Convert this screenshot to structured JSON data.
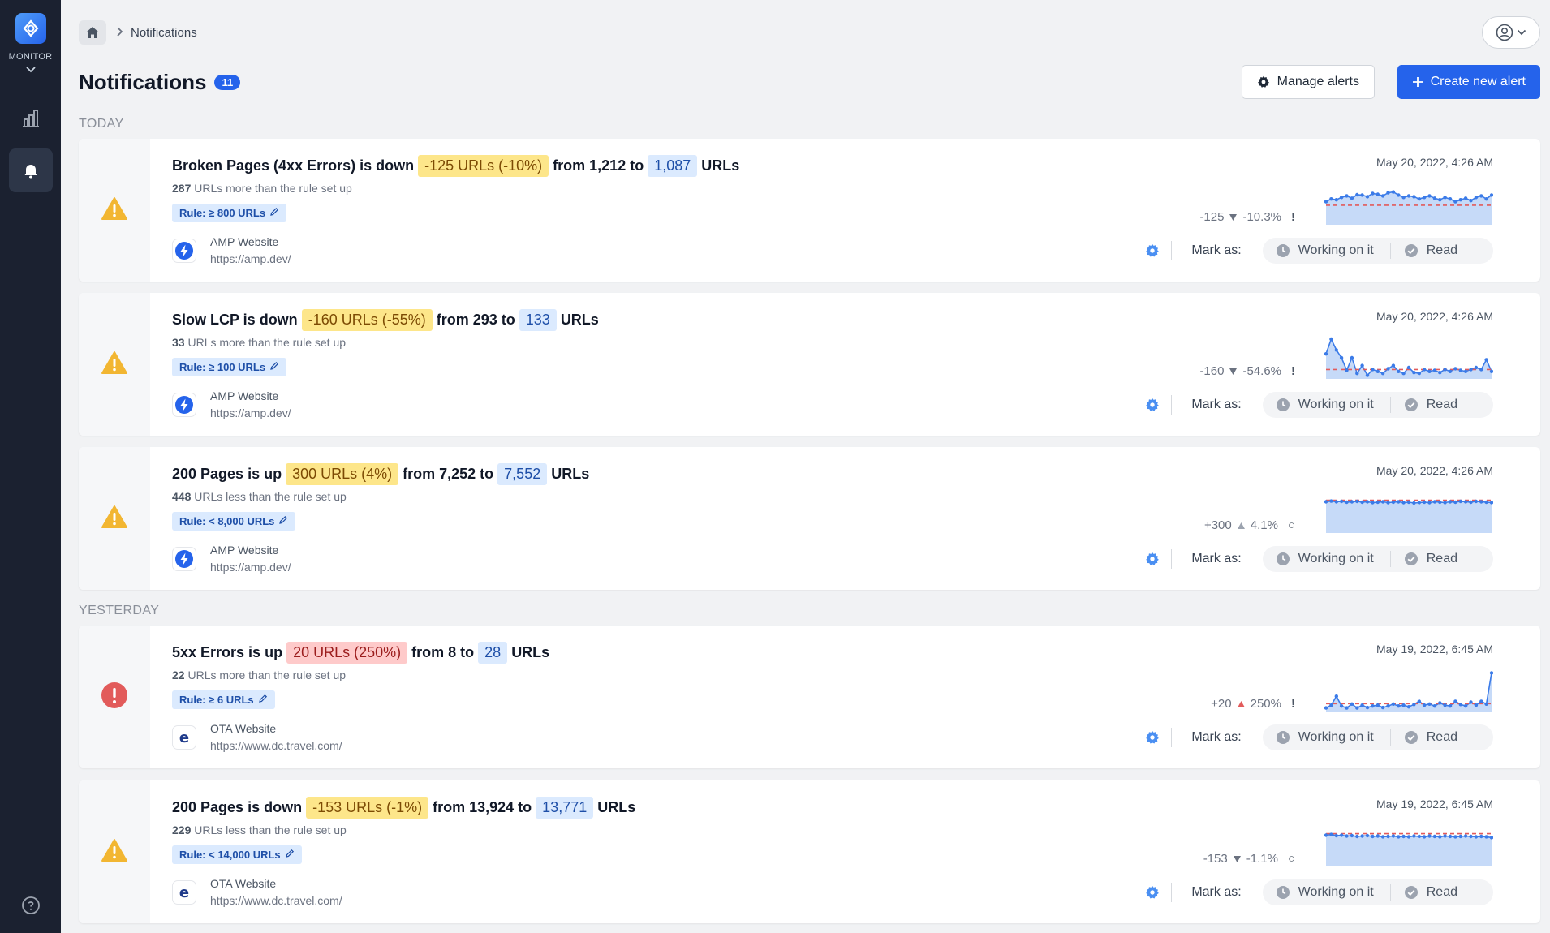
{
  "sidebar": {
    "app_label": "MONITOR",
    "items": [
      {
        "name": "charts",
        "icon": "bar-chart-icon"
      },
      {
        "name": "notifications",
        "icon": "bell-icon",
        "active": true
      }
    ],
    "help_icon": "help-icon"
  },
  "breadcrumb": {
    "home_icon": "home-icon",
    "current": "Notifications"
  },
  "header": {
    "title": "Notifications",
    "count": "11",
    "manage_label": "Manage alerts",
    "create_label": "Create new alert"
  },
  "sections": {
    "today": "TODAY",
    "yesterday": "YESTERDAY"
  },
  "mark_as_label": "Mark as:",
  "working_label": "Working on it",
  "read_label": "Read",
  "colors": {
    "accent": "#2563eb",
    "warning": "#f2b632",
    "error": "#e25b5b"
  },
  "notifications": [
    {
      "severity": "warning",
      "metric": "Broken Pages (4xx Errors) is down",
      "change": "-125 URLs (-10%)",
      "change_color": "yellow",
      "from_text": "from 1,212 to",
      "to_value": "1,087",
      "unit": "URLs",
      "sub_count": "287",
      "sub_text": "URLs more than the rule set up",
      "rule": "Rule: ≥ 800 URLs",
      "site_name": "AMP Website",
      "site_url": "https://amp.dev/",
      "site_icon": "amp",
      "date": "May 20, 2022, 4:26 AM",
      "delta": "-125",
      "direction": "down",
      "pct": "-10.3%",
      "status_mark": "!",
      "spark": [
        0.55,
        0.62,
        0.6,
        0.66,
        0.7,
        0.64,
        0.73,
        0.72,
        0.68,
        0.76,
        0.74,
        0.7,
        0.78,
        0.8,
        0.72,
        0.66,
        0.7,
        0.68,
        0.62,
        0.66,
        0.7,
        0.64,
        0.6,
        0.66,
        0.62,
        0.55,
        0.6,
        0.64,
        0.58,
        0.66,
        0.7,
        0.62,
        0.72
      ],
      "threshold": 0.46
    },
    {
      "severity": "warning",
      "metric": "Slow LCP is down",
      "change": "-160 URLs (-55%)",
      "change_color": "yellow",
      "from_text": "from 293 to",
      "to_value": "133",
      "unit": "URLs",
      "sub_count": "33",
      "sub_text": "URLs more than the rule set up",
      "rule": "Rule: ≥ 100 URLs",
      "site_name": "AMP Website",
      "site_url": "https://amp.dev/",
      "site_icon": "amp",
      "date": "May 20, 2022, 4:26 AM",
      "delta": "-160",
      "direction": "down",
      "pct": "-54.6%",
      "status_mark": "!",
      "spark": [
        0.6,
        0.98,
        0.7,
        0.5,
        0.18,
        0.5,
        0.1,
        0.3,
        0.05,
        0.2,
        0.15,
        0.1,
        0.22,
        0.3,
        0.15,
        0.1,
        0.25,
        0.12,
        0.1,
        0.2,
        0.15,
        0.18,
        0.12,
        0.2,
        0.15,
        0.22,
        0.18,
        0.15,
        0.2,
        0.25,
        0.2,
        0.45,
        0.15
      ],
      "threshold": 0.2
    },
    {
      "severity": "warning",
      "metric": "200 Pages is up",
      "change": "300 URLs (4%)",
      "change_color": "yellow",
      "from_text": "from 7,252 to",
      "to_value": "7,552",
      "unit": "URLs",
      "sub_count": "448",
      "sub_text": "URLs less than the rule set up",
      "rule": "Rule: < 8,000 URLs",
      "site_name": "AMP Website",
      "site_url": "https://amp.dev/",
      "site_icon": "amp",
      "date": "May 20, 2022, 4:26 AM",
      "delta": "+300",
      "direction": "up",
      "pct": "4.1%",
      "status_mark": "○",
      "spark": [
        0.76,
        0.78,
        0.76,
        0.77,
        0.75,
        0.76,
        0.77,
        0.75,
        0.76,
        0.74,
        0.75,
        0.76,
        0.74,
        0.75,
        0.76,
        0.74,
        0.75,
        0.73,
        0.74,
        0.75,
        0.74,
        0.76,
        0.75,
        0.74,
        0.76,
        0.75,
        0.77,
        0.76,
        0.75,
        0.77,
        0.76,
        0.75,
        0.74
      ],
      "threshold": 0.8
    },
    {
      "severity": "error",
      "metric": "5xx Errors is up",
      "change": "20 URLs (250%)",
      "change_color": "red",
      "from_text": "from 8 to",
      "to_value": "28",
      "unit": "URLs",
      "sub_count": "22",
      "sub_text": "URLs more than the rule set up",
      "rule": "Rule: ≥ 6 URLs",
      "site_name": "OTA Website",
      "site_url": "https://www.dc.travel.com/",
      "site_icon": "e",
      "date": "May 19, 2022, 6:45 AM",
      "delta": "+20",
      "direction": "up",
      "pct": "250%",
      "status_mark": "!",
      "spark": [
        0.05,
        0.12,
        0.35,
        0.1,
        0.05,
        0.15,
        0.05,
        0.12,
        0.06,
        0.1,
        0.12,
        0.06,
        0.1,
        0.15,
        0.1,
        0.12,
        0.08,
        0.14,
        0.22,
        0.12,
        0.15,
        0.1,
        0.18,
        0.12,
        0.1,
        0.22,
        0.14,
        0.1,
        0.2,
        0.12,
        0.22,
        0.15,
        0.95
      ],
      "threshold": 0.16
    },
    {
      "severity": "warning",
      "metric": "200 Pages is down",
      "change": "-153 URLs (-1%)",
      "change_color": "yellow",
      "from_text": "from 13,924 to",
      "to_value": "13,771",
      "unit": "URLs",
      "sub_count": "229",
      "sub_text": "URLs less than the rule set up",
      "rule": "Rule: < 14,000 URLs",
      "site_name": "OTA Website",
      "site_url": "https://www.dc.travel.com/",
      "site_icon": "e",
      "date": "May 19, 2022, 6:45 AM",
      "delta": "-153",
      "direction": "down",
      "pct": "-1.1%",
      "status_mark": "○",
      "spark": [
        0.76,
        0.78,
        0.75,
        0.76,
        0.74,
        0.75,
        0.73,
        0.74,
        0.75,
        0.73,
        0.74,
        0.72,
        0.73,
        0.74,
        0.72,
        0.73,
        0.72,
        0.74,
        0.73,
        0.72,
        0.74,
        0.73,
        0.72,
        0.74,
        0.73,
        0.72,
        0.73,
        0.74,
        0.73,
        0.72,
        0.73,
        0.72,
        0.7
      ],
      "threshold": 0.8
    }
  ]
}
